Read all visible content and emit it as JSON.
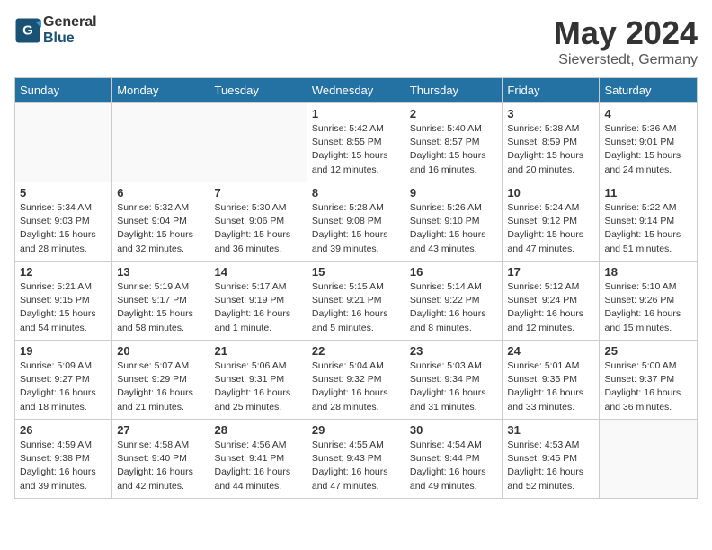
{
  "logo": {
    "general": "General",
    "blue": "Blue"
  },
  "title": {
    "month": "May 2024",
    "location": "Sieverstedt, Germany"
  },
  "weekdays": [
    "Sunday",
    "Monday",
    "Tuesday",
    "Wednesday",
    "Thursday",
    "Friday",
    "Saturday"
  ],
  "weeks": [
    [
      {
        "day": "",
        "info": ""
      },
      {
        "day": "",
        "info": ""
      },
      {
        "day": "",
        "info": ""
      },
      {
        "day": "1",
        "info": "Sunrise: 5:42 AM\nSunset: 8:55 PM\nDaylight: 15 hours\nand 12 minutes."
      },
      {
        "day": "2",
        "info": "Sunrise: 5:40 AM\nSunset: 8:57 PM\nDaylight: 15 hours\nand 16 minutes."
      },
      {
        "day": "3",
        "info": "Sunrise: 5:38 AM\nSunset: 8:59 PM\nDaylight: 15 hours\nand 20 minutes."
      },
      {
        "day": "4",
        "info": "Sunrise: 5:36 AM\nSunset: 9:01 PM\nDaylight: 15 hours\nand 24 minutes."
      }
    ],
    [
      {
        "day": "5",
        "info": "Sunrise: 5:34 AM\nSunset: 9:03 PM\nDaylight: 15 hours\nand 28 minutes."
      },
      {
        "day": "6",
        "info": "Sunrise: 5:32 AM\nSunset: 9:04 PM\nDaylight: 15 hours\nand 32 minutes."
      },
      {
        "day": "7",
        "info": "Sunrise: 5:30 AM\nSunset: 9:06 PM\nDaylight: 15 hours\nand 36 minutes."
      },
      {
        "day": "8",
        "info": "Sunrise: 5:28 AM\nSunset: 9:08 PM\nDaylight: 15 hours\nand 39 minutes."
      },
      {
        "day": "9",
        "info": "Sunrise: 5:26 AM\nSunset: 9:10 PM\nDaylight: 15 hours\nand 43 minutes."
      },
      {
        "day": "10",
        "info": "Sunrise: 5:24 AM\nSunset: 9:12 PM\nDaylight: 15 hours\nand 47 minutes."
      },
      {
        "day": "11",
        "info": "Sunrise: 5:22 AM\nSunset: 9:14 PM\nDaylight: 15 hours\nand 51 minutes."
      }
    ],
    [
      {
        "day": "12",
        "info": "Sunrise: 5:21 AM\nSunset: 9:15 PM\nDaylight: 15 hours\nand 54 minutes."
      },
      {
        "day": "13",
        "info": "Sunrise: 5:19 AM\nSunset: 9:17 PM\nDaylight: 15 hours\nand 58 minutes."
      },
      {
        "day": "14",
        "info": "Sunrise: 5:17 AM\nSunset: 9:19 PM\nDaylight: 16 hours\nand 1 minute."
      },
      {
        "day": "15",
        "info": "Sunrise: 5:15 AM\nSunset: 9:21 PM\nDaylight: 16 hours\nand 5 minutes."
      },
      {
        "day": "16",
        "info": "Sunrise: 5:14 AM\nSunset: 9:22 PM\nDaylight: 16 hours\nand 8 minutes."
      },
      {
        "day": "17",
        "info": "Sunrise: 5:12 AM\nSunset: 9:24 PM\nDaylight: 16 hours\nand 12 minutes."
      },
      {
        "day": "18",
        "info": "Sunrise: 5:10 AM\nSunset: 9:26 PM\nDaylight: 16 hours\nand 15 minutes."
      }
    ],
    [
      {
        "day": "19",
        "info": "Sunrise: 5:09 AM\nSunset: 9:27 PM\nDaylight: 16 hours\nand 18 minutes."
      },
      {
        "day": "20",
        "info": "Sunrise: 5:07 AM\nSunset: 9:29 PM\nDaylight: 16 hours\nand 21 minutes."
      },
      {
        "day": "21",
        "info": "Sunrise: 5:06 AM\nSunset: 9:31 PM\nDaylight: 16 hours\nand 25 minutes."
      },
      {
        "day": "22",
        "info": "Sunrise: 5:04 AM\nSunset: 9:32 PM\nDaylight: 16 hours\nand 28 minutes."
      },
      {
        "day": "23",
        "info": "Sunrise: 5:03 AM\nSunset: 9:34 PM\nDaylight: 16 hours\nand 31 minutes."
      },
      {
        "day": "24",
        "info": "Sunrise: 5:01 AM\nSunset: 9:35 PM\nDaylight: 16 hours\nand 33 minutes."
      },
      {
        "day": "25",
        "info": "Sunrise: 5:00 AM\nSunset: 9:37 PM\nDaylight: 16 hours\nand 36 minutes."
      }
    ],
    [
      {
        "day": "26",
        "info": "Sunrise: 4:59 AM\nSunset: 9:38 PM\nDaylight: 16 hours\nand 39 minutes."
      },
      {
        "day": "27",
        "info": "Sunrise: 4:58 AM\nSunset: 9:40 PM\nDaylight: 16 hours\nand 42 minutes."
      },
      {
        "day": "28",
        "info": "Sunrise: 4:56 AM\nSunset: 9:41 PM\nDaylight: 16 hours\nand 44 minutes."
      },
      {
        "day": "29",
        "info": "Sunrise: 4:55 AM\nSunset: 9:43 PM\nDaylight: 16 hours\nand 47 minutes."
      },
      {
        "day": "30",
        "info": "Sunrise: 4:54 AM\nSunset: 9:44 PM\nDaylight: 16 hours\nand 49 minutes."
      },
      {
        "day": "31",
        "info": "Sunrise: 4:53 AM\nSunset: 9:45 PM\nDaylight: 16 hours\nand 52 minutes."
      },
      {
        "day": "",
        "info": ""
      }
    ]
  ]
}
